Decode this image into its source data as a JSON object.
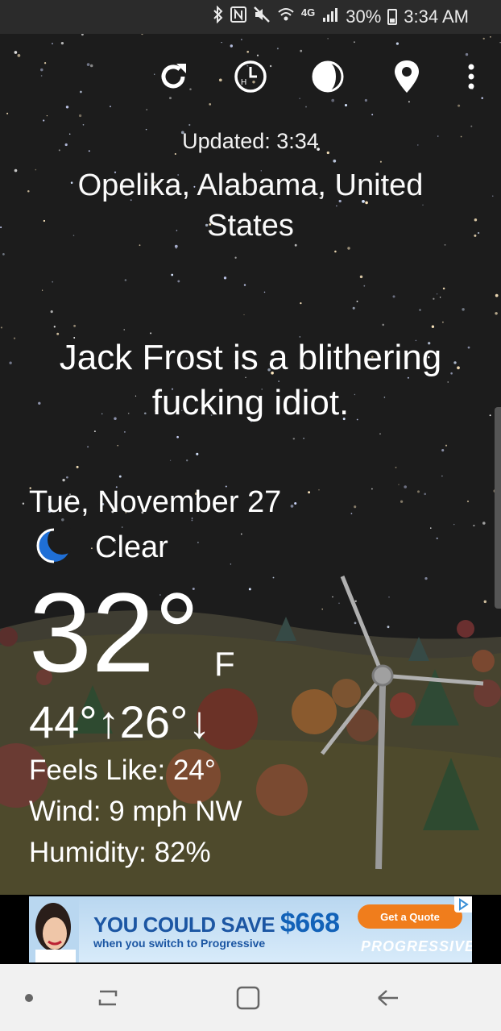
{
  "status_bar": {
    "icons": [
      "bluetooth-icon",
      "nfc-icon",
      "mute-icon",
      "wifi-icon",
      "4g-lte-icon",
      "signal-icon",
      "battery-icon"
    ],
    "network": "4G",
    "battery": "30%",
    "time": "3:34 AM"
  },
  "toolbar": {
    "icons": [
      "refresh-icon",
      "hourly-clock-icon",
      "moon-phase-icon",
      "location-pin-icon",
      "overflow-menu-icon"
    ]
  },
  "weather": {
    "updated": "Updated: 3:34",
    "location": "Opelika, Alabama, United States",
    "quote": "Jack Frost is a blithering fucking idiot.",
    "date": "Tue, November 27",
    "condition_icon": "crescent-moon-icon",
    "condition": "Clear",
    "temperature": "32°",
    "unit": "F",
    "high_low": "44°↑26°↓",
    "feels_like": "Feels Like: 24°",
    "wind": "Wind: 9 mph NW",
    "humidity": "Humidity: 82%"
  },
  "ad": {
    "headline_prefix": "YOU COULD SAVE",
    "amount": "$668",
    "subline": "when you switch to Progressive",
    "cta": "Get a Quote",
    "brand": "PROGRESSIVE"
  },
  "nav_bar": {
    "icons": [
      "dot-indicator-icon",
      "recent-apps-icon",
      "home-icon",
      "back-icon"
    ]
  },
  "colors": {
    "sky": "#1c1c1c",
    "moon_icon": "#1f6fd6",
    "ad_blue": "#1c56a3",
    "ad_orange": "#f07d1c"
  }
}
